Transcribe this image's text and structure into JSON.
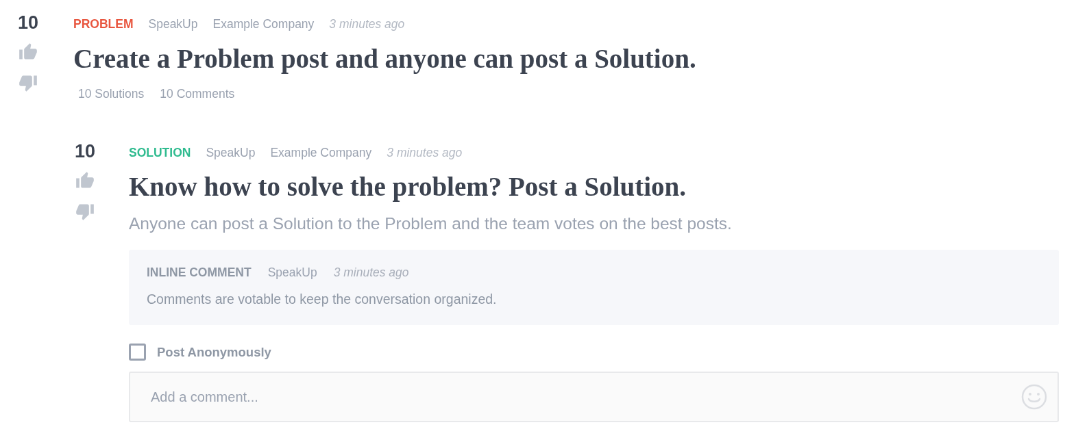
{
  "problem": {
    "score": "10",
    "type_label": "PROBLEM",
    "color": "#e8553e",
    "author": "SpeakUp",
    "company": "Example Company",
    "time": "3 minutes ago",
    "title": "Create a Problem post and anyone can post a Solution.",
    "stats": [
      "10 Solutions",
      "10 Comments"
    ]
  },
  "solutions": [
    {
      "score": "10",
      "type_label": "SOLUTION",
      "color": "#2fbb8f",
      "author": "SpeakUp",
      "company": "Example Company",
      "time": "3 minutes ago",
      "title": "Know how to solve the problem? Post a Solution.",
      "description": "Anyone can post a Solution to the Problem and the team votes on the best posts.",
      "comments": [
        {
          "label": "INLINE COMMENT",
          "author": "SpeakUp",
          "time": "3 minutes ago",
          "text": "Comments are votable to keep the conversation organized."
        }
      ],
      "reply": {
        "anonymous": {
          "label": "Post Anonymously",
          "checked": false
        },
        "placeholder": "Add a comment..."
      }
    }
  ]
}
